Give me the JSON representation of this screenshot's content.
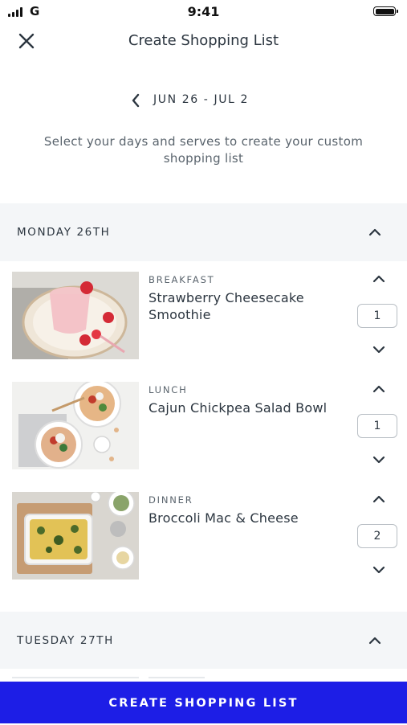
{
  "status_bar": {
    "carrier": "G",
    "time": "9:41"
  },
  "nav": {
    "title": "Create Shopping List",
    "close_icon": "close-icon"
  },
  "week": {
    "range": "JUN 26 - JUL 2",
    "prev_icon": "chevron-left-icon"
  },
  "intro_text": "Select your days and serves to create your custom shopping list",
  "days": [
    {
      "label": "MONDAY 26TH",
      "expanded": true,
      "meals": [
        {
          "type": "BREAKFAST",
          "name": "Strawberry Cheesecake Smoothie",
          "serves": "1"
        },
        {
          "type": "LUNCH",
          "name": "Cajun Chickpea Salad Bowl",
          "serves": "1"
        },
        {
          "type": "DINNER",
          "name": "Broccoli Mac & Cheese",
          "serves": "2"
        }
      ]
    },
    {
      "label": "TUESDAY 27TH",
      "expanded": true
    }
  ],
  "cta": {
    "label": "CREATE SHOPPING LIST"
  },
  "colors": {
    "accent": "#1d1ee6",
    "text": "#2c3640",
    "muted": "#5a646d",
    "section_bg": "#f4f6f8"
  }
}
